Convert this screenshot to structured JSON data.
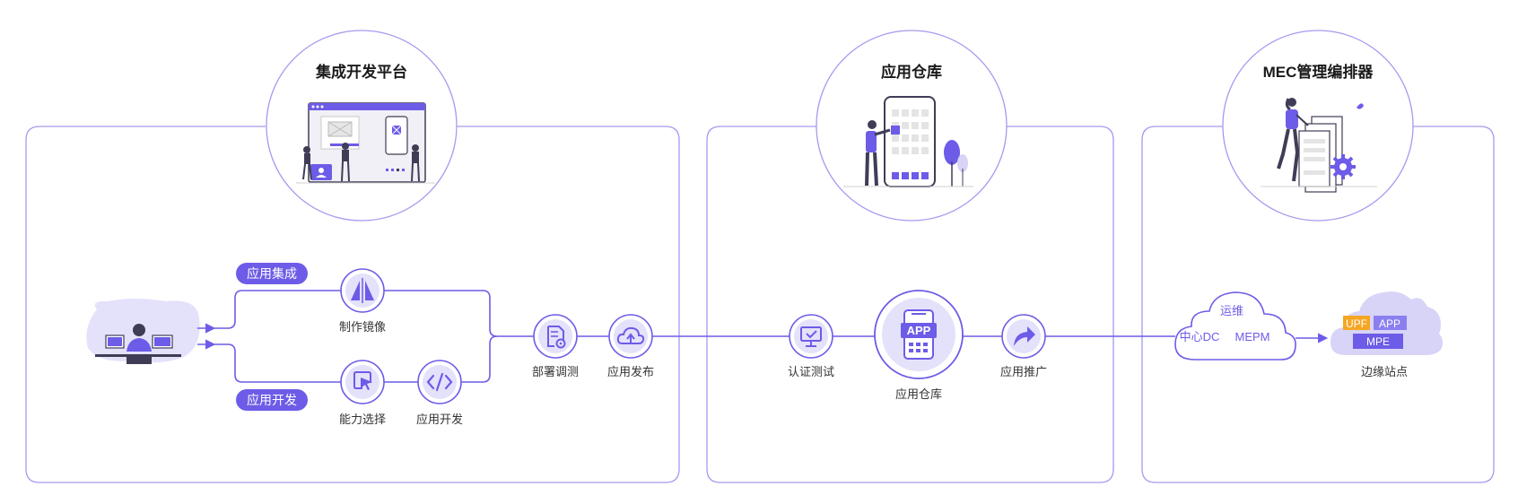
{
  "colors": {
    "accent": "#6c5ce7",
    "accent_light": "#e4e1fb",
    "panel_border": "#a39af0",
    "text": "#333333",
    "yellow": "#f5a623"
  },
  "panels": {
    "dev": {
      "title": "集成开发平台"
    },
    "store": {
      "title": "应用仓库"
    },
    "mec": {
      "title": "MEC管理编排器"
    }
  },
  "badges": {
    "integration": "应用集成",
    "development": "应用开发"
  },
  "nodes": {
    "make_image": "制作镜像",
    "capability_select": "能力选择",
    "app_develop": "应用开发",
    "deploy_debug": "部署调测",
    "app_publish": "应用发布",
    "cert_test": "认证测试",
    "app_store": "应用仓库",
    "app_promote": "应用推广",
    "edge_site": "边缘站点"
  },
  "cloud": {
    "ops": "运维",
    "dc": "中心DC",
    "mepm": "MEPM"
  },
  "edge_tags": {
    "upf": "UPF",
    "app": "APP",
    "mpe": "MPE"
  },
  "phone_label": "APP",
  "icons": [
    "user-at-desk-illustration",
    "mirror-icon",
    "cursor-icon",
    "code-icon",
    "document-gear-icon",
    "cloud-upload-icon",
    "monitor-check-icon",
    "phone-app-icon",
    "share-arrow-icon"
  ]
}
